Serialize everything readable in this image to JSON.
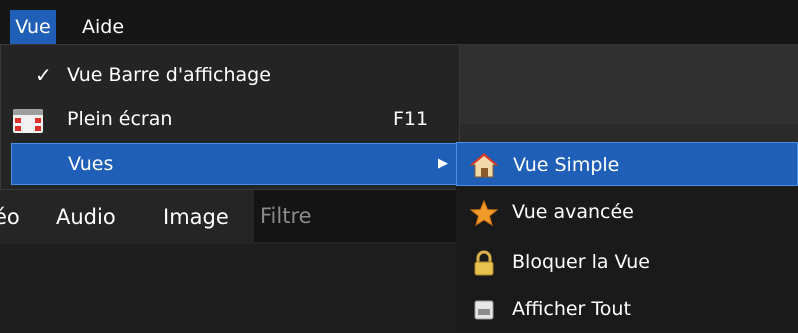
{
  "menubar": {
    "items": [
      "Vue",
      "Aide"
    ]
  },
  "menu": {
    "items": [
      {
        "label": "Vue Barre d'affichage",
        "checked": true,
        "check_glyph": "✓"
      },
      {
        "label": "Plein écran",
        "icon": "fullscreen-icon",
        "shortcut": "F11"
      },
      {
        "label": "Vues",
        "has_submenu": true,
        "arrow": "▶"
      }
    ]
  },
  "submenu": {
    "items": [
      {
        "label": "Vue Simple",
        "icon": "home-icon",
        "highlighted": true
      },
      {
        "label": "Vue avancée",
        "icon": "star-icon"
      },
      {
        "label": "Bloquer la Vue",
        "icon": "lock-icon"
      },
      {
        "label": "Afficher Tout",
        "icon": "window-icon"
      }
    ]
  },
  "tabs": [
    "éo",
    "Audio",
    "Image"
  ],
  "filter": {
    "placeholder": "Filtre"
  },
  "colors": {
    "highlight": "#1f5fb8",
    "highlight_border": "#4a8fe6",
    "background": "#1e1e1e"
  }
}
